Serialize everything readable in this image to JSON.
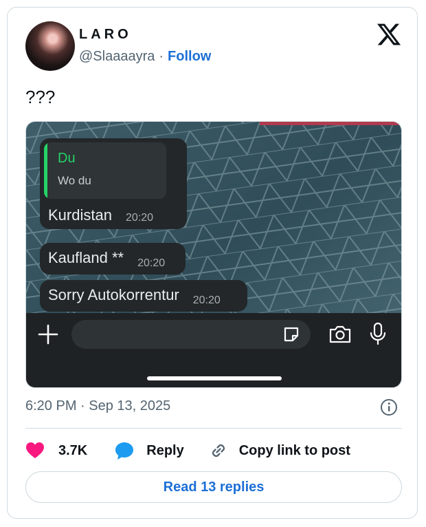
{
  "author": {
    "name": "LARO",
    "handle": "@Slaaaayra",
    "separator": "·",
    "follow_label": "Follow"
  },
  "tweet": {
    "text": "???"
  },
  "media": {
    "chat": {
      "quote": {
        "name": "Du",
        "text": "Wo du"
      },
      "messages": [
        {
          "text": "Kurdistan",
          "time": "20:20"
        },
        {
          "text": "Kaufland **",
          "time": "20:20"
        },
        {
          "text": "Sorry Autokorrentur",
          "time": "20:20"
        }
      ]
    },
    "icons": [
      "plus-icon",
      "sticker-icon",
      "camera-icon",
      "microphone-icon"
    ],
    "colors": {
      "quote_accent": "#25d366",
      "bubble": "#232729"
    }
  },
  "meta": {
    "timestamp": "6:20 PM · Sep 13, 2025"
  },
  "actions": {
    "likes": "3.7K",
    "reply_label": "Reply",
    "copy_label": "Copy link to post"
  },
  "footer": {
    "read_replies_label": "Read 13 replies"
  },
  "colors": {
    "link": "#1d6fd6",
    "heart": "#f91880",
    "reply_bubble": "#1d9bf0"
  }
}
